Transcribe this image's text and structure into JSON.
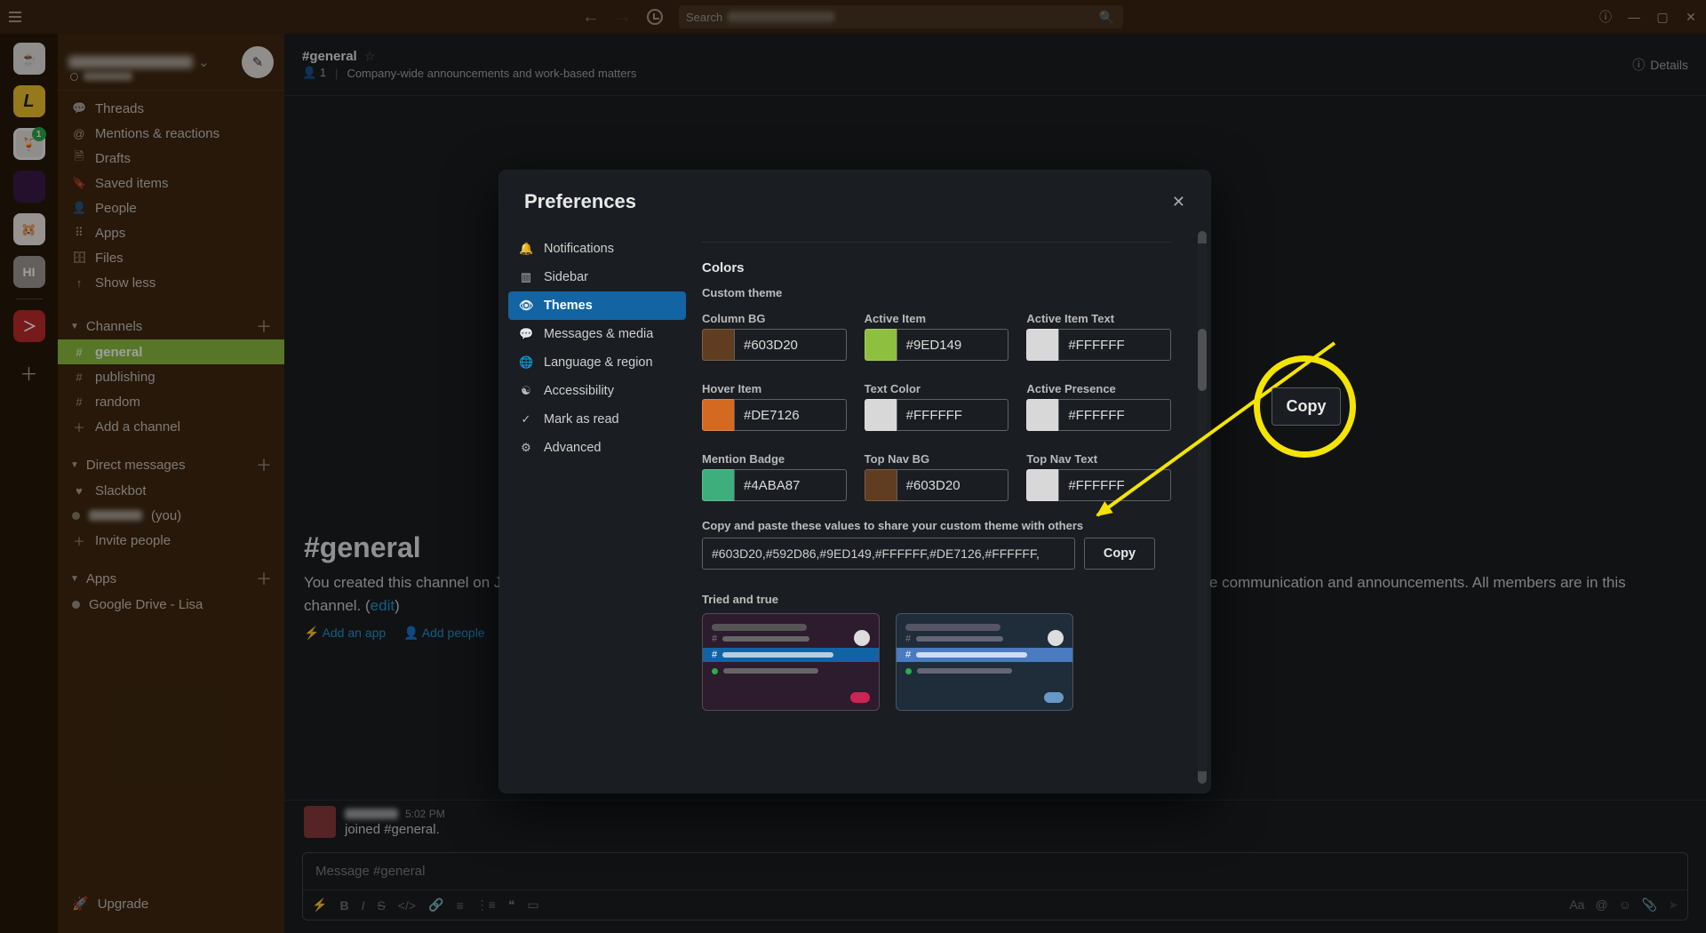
{
  "topnav": {
    "search_label": "Search",
    "help_tooltip": "Help",
    "minimize": "—",
    "maximize": "▢",
    "close": "✕"
  },
  "workspaces": {
    "badge": "1",
    "hi": "HI"
  },
  "sidebar": {
    "compose_tooltip": "New message",
    "nav": {
      "threads": "Threads",
      "mentions": "Mentions & reactions",
      "drafts": "Drafts",
      "saved": "Saved items",
      "people": "People",
      "apps": "Apps",
      "files": "Files",
      "less": "Show less"
    },
    "channels": {
      "header": "Channels",
      "items": [
        "general",
        "publishing",
        "random"
      ],
      "add": "Add a channel"
    },
    "dms": {
      "header": "Direct messages",
      "items": [
        {
          "name": "Slackbot"
        },
        {
          "name_hidden": true,
          "suffix": "(you)"
        }
      ],
      "invite": "Invite people"
    },
    "apps_section": {
      "header": "Apps",
      "items": [
        "Google Drive - Lisa"
      ]
    },
    "upgrade": "Upgrade"
  },
  "channel": {
    "title": "#general",
    "members": "1",
    "topic": "Company-wide announcements and work-based matters",
    "details": "Details",
    "big_title": "#general",
    "created_prefix": "You created this channel on ",
    "created_rest": "space-wide communication and announcements. All members are in this channel. (",
    "edit": "edit",
    "created_close": ")",
    "add_app": "Add an app",
    "add_people": "Add people",
    "msg_joined": "joined #general.",
    "msg_time": "5:02 PM",
    "composer_placeholder": "Message #general"
  },
  "prefs": {
    "title": "Preferences",
    "nav": [
      "Notifications",
      "Sidebar",
      "Themes",
      "Messages & media",
      "Language & region",
      "Accessibility",
      "Mark as read",
      "Advanced"
    ],
    "active_index": 2,
    "pane": {
      "heading": "Colors",
      "custom_label": "Custom theme",
      "fields": [
        {
          "label": "Column BG",
          "hex": "#603D20",
          "swatch": "#603D20"
        },
        {
          "label": "Active Item",
          "hex": "#9ED149",
          "swatch": "#8fbf3f"
        },
        {
          "label": "Active Item Text",
          "hex": "#FFFFFF",
          "swatch": "#d8d8d8"
        },
        {
          "label": "Hover Item",
          "hex": "#DE7126",
          "swatch": "#d46a21"
        },
        {
          "label": "Text Color",
          "hex": "#FFFFFF",
          "swatch": "#d8d8d8"
        },
        {
          "label": "Active Presence",
          "hex": "#FFFFFF",
          "swatch": "#d8d8d8"
        },
        {
          "label": "Mention Badge",
          "hex": "#4ABA87",
          "swatch": "#3fae7d"
        },
        {
          "label": "Top Nav BG",
          "hex": "#603D20",
          "swatch": "#603D20"
        },
        {
          "label": "Top Nav Text",
          "hex": "#FFFFFF",
          "swatch": "#d8d8d8"
        }
      ],
      "share_label": "Copy and paste these values to share your custom theme with others",
      "share_value": "#603D20,#592D86,#9ED149,#FFFFFF,#DE7126,#FFFFFF,",
      "copy": "Copy",
      "tried": "Tried and true"
    }
  },
  "annotation": {
    "copy": "Copy"
  }
}
